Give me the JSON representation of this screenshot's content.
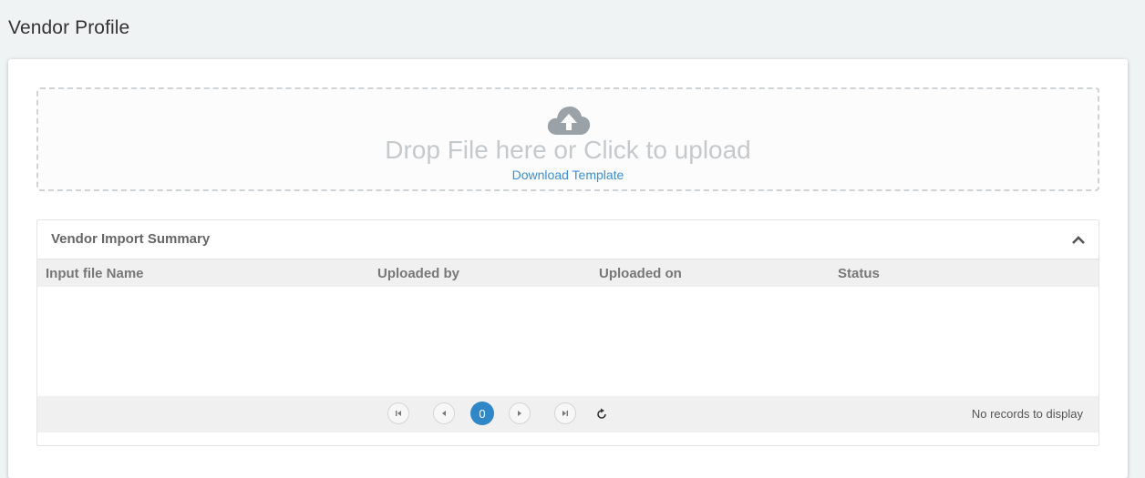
{
  "page": {
    "title": "Vendor Profile"
  },
  "upload": {
    "icon": "cloud-upload-icon",
    "drop_text": "Drop File here or Click to upload",
    "download_link": "Download Template"
  },
  "summary": {
    "title": "Vendor Import Summary",
    "collapse_icon": "chevron-up-icon",
    "columns": [
      "Input file Name",
      "Uploaded by",
      "Uploaded on",
      "Status"
    ],
    "rows": []
  },
  "pager": {
    "first_icon": "first-page-icon",
    "prev_icon": "prev-page-icon",
    "current_page": "0",
    "next_icon": "next-page-icon",
    "last_icon": "last-page-icon",
    "refresh_icon": "refresh-icon",
    "status_text": "No records to display"
  },
  "colors": {
    "accent": "#2f87c8",
    "link": "#3b8fd8",
    "page_bg": "#f0f3f4"
  }
}
